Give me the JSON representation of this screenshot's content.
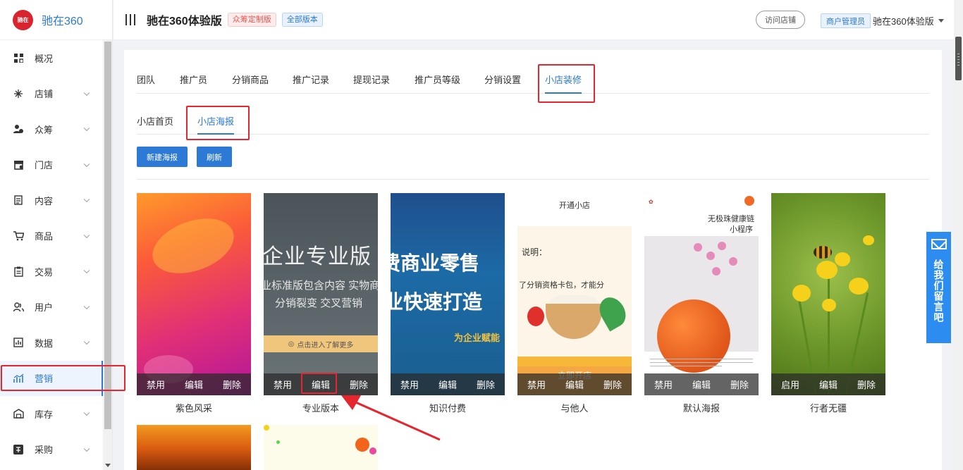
{
  "brand": {
    "name": "驰在360",
    "logo_text": "驰在"
  },
  "header": {
    "title": "驰在360体验版",
    "badges": [
      "众筹定制版",
      "全部版本"
    ],
    "visit_store": "访问店铺",
    "role": "商户管理员",
    "store_name": "驰在360体验版"
  },
  "sidebar": {
    "items": [
      {
        "label": "概况",
        "icon": "grid-icon",
        "expandable": false
      },
      {
        "label": "店铺",
        "icon": "sparkle-icon",
        "expandable": true
      },
      {
        "label": "众筹",
        "icon": "user-coin-icon",
        "expandable": true
      },
      {
        "label": "门店",
        "icon": "shop-icon",
        "expandable": true
      },
      {
        "label": "内容",
        "icon": "document-icon",
        "expandable": true
      },
      {
        "label": "商品",
        "icon": "cart-icon",
        "expandable": true
      },
      {
        "label": "交易",
        "icon": "clipboard-icon",
        "expandable": true
      },
      {
        "label": "用户",
        "icon": "users-icon",
        "expandable": true
      },
      {
        "label": "数据",
        "icon": "chart-icon",
        "expandable": true
      },
      {
        "label": "营销",
        "icon": "marketing-icon",
        "expandable": true,
        "active": true
      },
      {
        "label": "库存",
        "icon": "warehouse-icon",
        "expandable": true
      },
      {
        "label": "采购",
        "icon": "purchase-icon",
        "expandable": true
      }
    ]
  },
  "tabs_primary": [
    "团队",
    "推广员",
    "分销商品",
    "推广记录",
    "提现记录",
    "推广员等级",
    "分销设置",
    "小店装修"
  ],
  "tabs_primary_active": "小店装修",
  "tabs_secondary": [
    "小店首页",
    "小店海报"
  ],
  "tabs_secondary_active": "小店海报",
  "buttons": {
    "new_poster": "新建海报",
    "refresh": "刷新"
  },
  "poster_actions": {
    "disable": "禁用",
    "enable": "启用",
    "edit": "编辑",
    "delete": "删除"
  },
  "posters": [
    {
      "name": "紫色风采",
      "state_action": "禁用"
    },
    {
      "name": "专业版本",
      "state_action": "禁用",
      "text": {
        "line1": "企业专业版",
        "line2": "业标准版包含内容 实物商",
        "line3": "分销裂变 交叉营销",
        "banner": "点击进入了解更多"
      }
    },
    {
      "name": "知识付费",
      "state_action": "禁用",
      "text": {
        "line1": "费商业零售",
        "line2": "业快速打造",
        "line3": "为企业赋能"
      }
    },
    {
      "name": "与他人",
      "state_action": "禁用",
      "text": {
        "top": "开通小店",
        "line1": "说明：",
        "line2": "了分销资格卡包，才能分",
        "bottom": "立即开店"
      }
    },
    {
      "name": "默认海报",
      "state_action": "禁用",
      "text": {
        "line1": "无极珠健康链",
        "line2": "小程序"
      }
    },
    {
      "name": "行者无疆",
      "state_action": "启用"
    }
  ],
  "feedback": {
    "label": "给我们留言吧"
  }
}
